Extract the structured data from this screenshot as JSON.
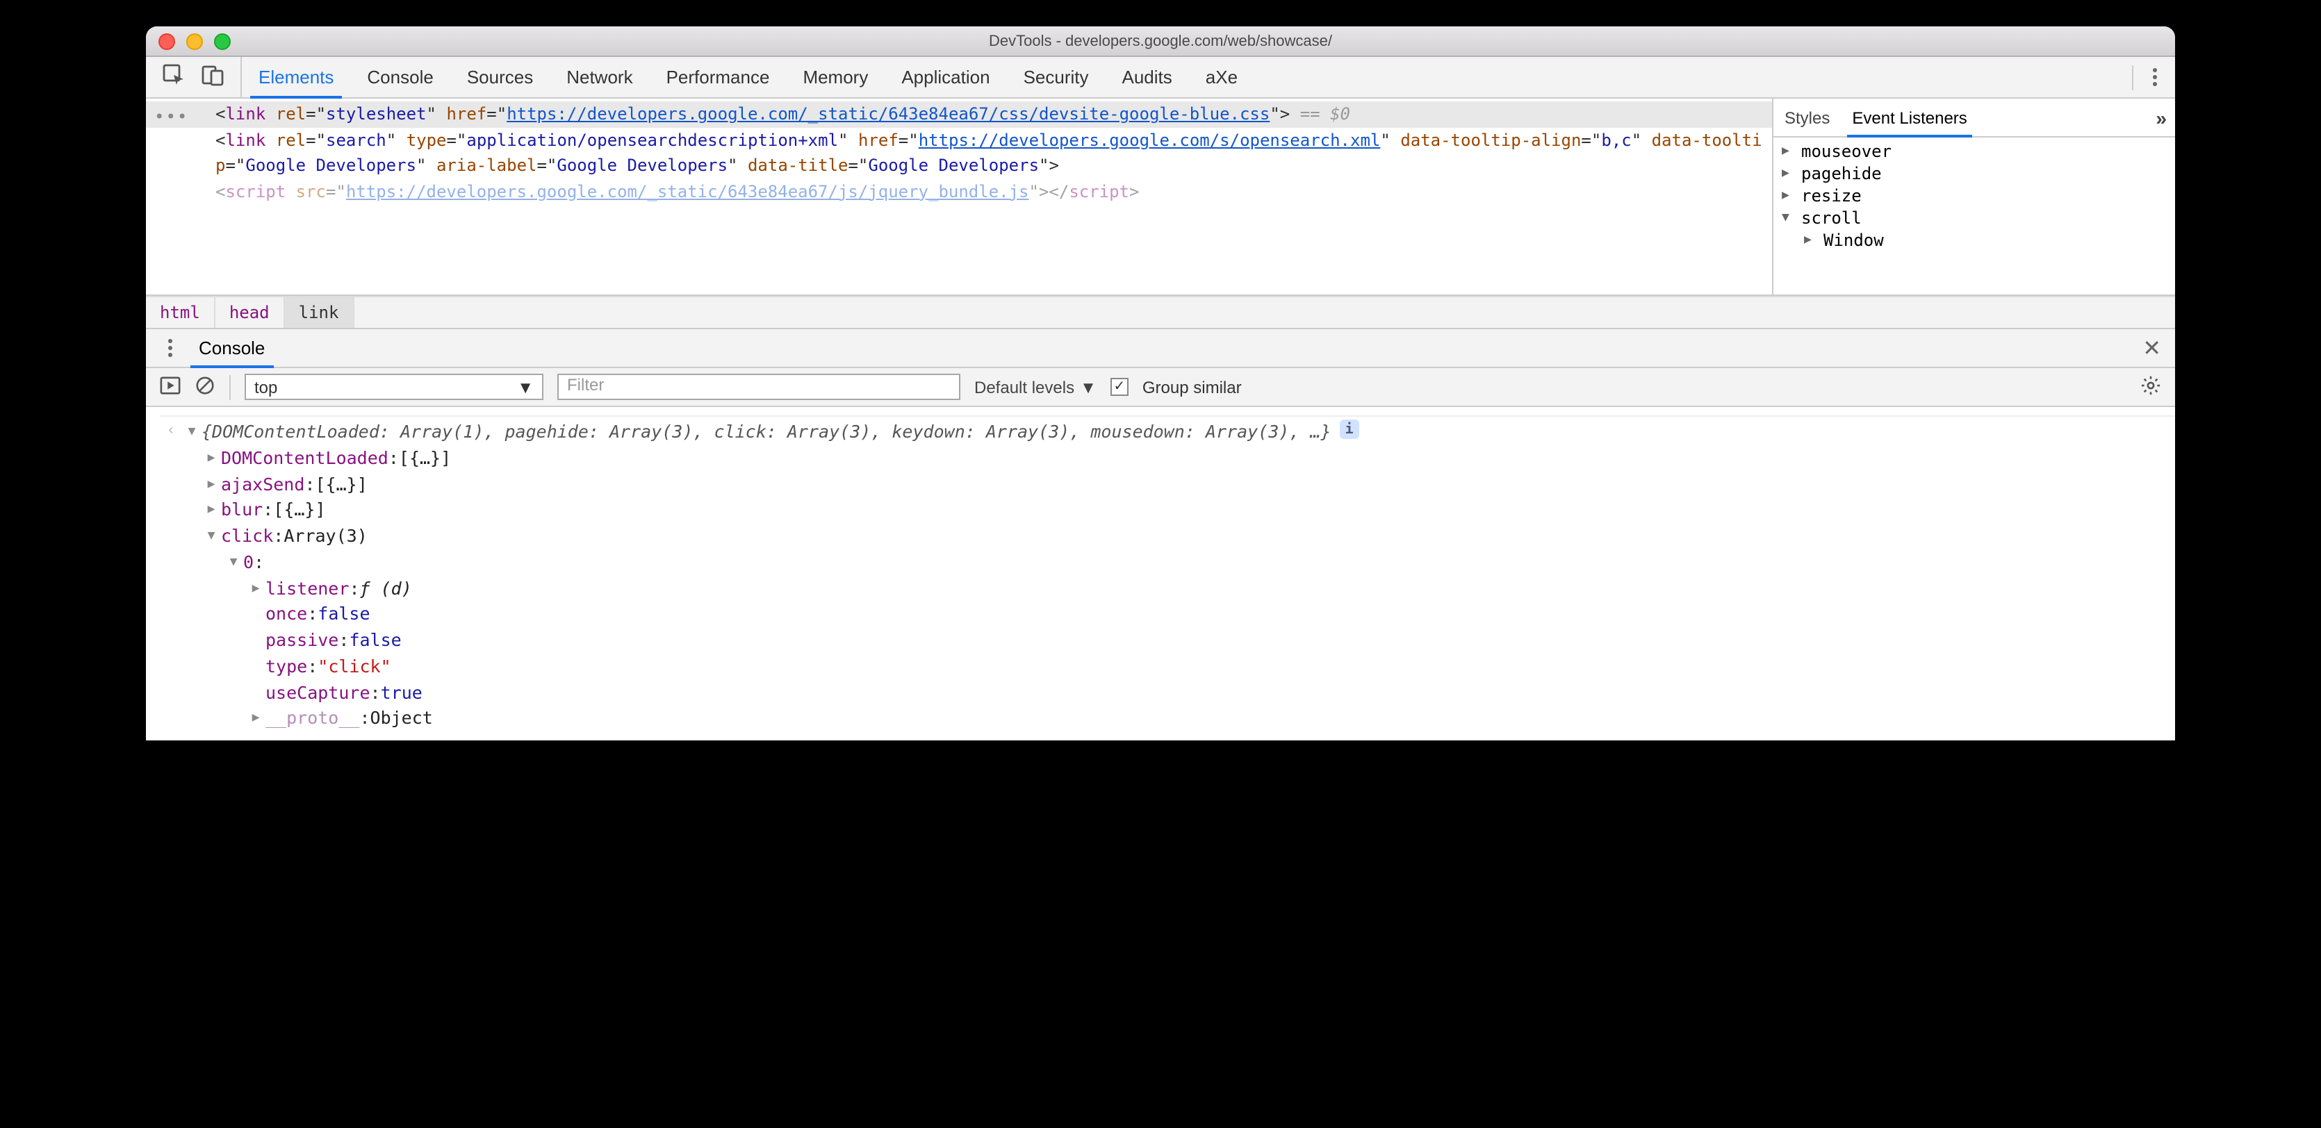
{
  "window": {
    "title": "DevTools - developers.google.com/web/showcase/"
  },
  "mainTabs": [
    "Elements",
    "Console",
    "Sources",
    "Network",
    "Performance",
    "Memory",
    "Application",
    "Security",
    "Audits",
    "aXe"
  ],
  "mainTabActive": "Elements",
  "elements": {
    "line1": {
      "tag": "link",
      "rel": "stylesheet",
      "hrefText": "https://developers.google.com/_static/643e84ea67/css/devsite-google-blue.css",
      "selectedSuffix": " == $0"
    },
    "line2": {
      "tag": "link",
      "rel": "search",
      "type": "application/opensearchdescription+xml",
      "hrefText": "https://developers.google.com/s/opensearch.xml",
      "tooltipAlignAttr": "data-tooltip-align",
      "tooltipAlignVal": "b,c",
      "tooltipAttr": "data-tooltip",
      "tooltipVal": "Google Developers",
      "ariaLabelAttr": "aria-label",
      "ariaLabelVal": "Google Developers",
      "titleAttr": "data-title",
      "titleVal": "Google Developers"
    },
    "line3": {
      "tag": "script",
      "src": "https://developers.google.com/_static/643e84ea67/js/jquery_bundle.js"
    }
  },
  "breadcrumb": [
    "html",
    "head",
    "link"
  ],
  "sidebar": {
    "tabs": [
      "Styles",
      "Event Listeners"
    ],
    "active": "Event Listeners",
    "more": "»",
    "events": [
      {
        "name": "mouseover",
        "expanded": false
      },
      {
        "name": "pagehide",
        "expanded": false
      },
      {
        "name": "resize",
        "expanded": false
      },
      {
        "name": "scroll",
        "expanded": true,
        "children": [
          {
            "name": "Window"
          }
        ]
      }
    ]
  },
  "drawer": {
    "tab": "Console"
  },
  "consoleToolbar": {
    "context": "top",
    "filterPlaceholder": "Filter",
    "levelsLabel": "Default levels",
    "groupSimilar": "Group similar"
  },
  "consoleOutput": {
    "summary": "{DOMContentLoaded: Array(1), pagehide: Array(3), click: Array(3), keydown: Array(3), mousedown: Array(3), …}",
    "rows": [
      {
        "indent": 1,
        "expand": "▶",
        "key": "DOMContentLoaded",
        "val": "[{…}]"
      },
      {
        "indent": 1,
        "expand": "▶",
        "key": "ajaxSend",
        "val": "[{…}]"
      },
      {
        "indent": 1,
        "expand": "▶",
        "key": "blur",
        "val": "[{…}]"
      },
      {
        "indent": 1,
        "expand": "▼",
        "key": "click",
        "val": "Array(3)"
      },
      {
        "indent": 2,
        "expand": "▼",
        "key": "0",
        "val": ""
      },
      {
        "indent": 3,
        "expand": "▶",
        "key": "listener",
        "val": "ƒ (d)",
        "fn": true
      },
      {
        "indent": 3,
        "expand": "",
        "key": "once",
        "val": "false",
        "bool": true
      },
      {
        "indent": 3,
        "expand": "",
        "key": "passive",
        "val": "false",
        "bool": true
      },
      {
        "indent": 3,
        "expand": "",
        "key": "type",
        "val": "\"click\"",
        "str": true
      },
      {
        "indent": 3,
        "expand": "",
        "key": "useCapture",
        "val": "true",
        "bool": true
      },
      {
        "indent": 3,
        "expand": "▶",
        "key": "__proto__",
        "val": "Object",
        "proto": true
      }
    ]
  }
}
